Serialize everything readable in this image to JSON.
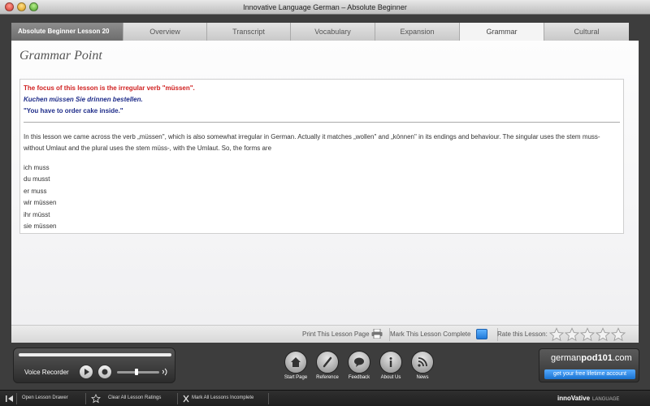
{
  "window": {
    "title": "Innovative Language German – Absolute Beginner"
  },
  "tabs": [
    {
      "label": "Absolute Beginner Lesson 20",
      "state": "current-lesson"
    },
    {
      "label": "Overview"
    },
    {
      "label": "Transcript"
    },
    {
      "label": "Vocabulary"
    },
    {
      "label": "Expansion"
    },
    {
      "label": "Grammar",
      "state": "active"
    },
    {
      "label": "Cultural"
    }
  ],
  "content": {
    "heading": "Grammar Point",
    "focus": "The focus of this lesson is the irregular verb \"müssen\".",
    "example_german": "Kuchen müssen Sie drinnen bestellen.",
    "example_english": "\"You have to order cake inside.\"",
    "paragraph": "In this lesson we came across the verb „müssen\", which is also somewhat irregular in German. Actually it matches „wollen\" and „können\" in its endings and behaviour. The singular uses the stem muss- without Umlaut and the plural uses the stem müss-, with the Umlaut. So, the forms are",
    "forms": [
      "ich muss",
      "du musst",
      "er muss",
      "wir müssen",
      "ihr müsst",
      "sie müssen"
    ]
  },
  "toolbar": {
    "print_label": "Print This Lesson Page",
    "mark_label": "Mark This Lesson Complete",
    "rate_label": "Rate this Lesson:",
    "rating": 0,
    "rating_max": 5
  },
  "recorder": {
    "label": "Voice Recorder",
    "volume_level": 0.45
  },
  "nav": [
    {
      "label": "Start Page",
      "icon": "home-icon"
    },
    {
      "label": "Reference",
      "icon": "reference-icon"
    },
    {
      "label": "Feedback",
      "icon": "feedback-icon"
    },
    {
      "label": "About Us",
      "icon": "info-icon"
    },
    {
      "label": "News",
      "icon": "rss-icon"
    }
  ],
  "promo": {
    "brand_left": "german",
    "brand_mid": "pod101",
    "brand_right": ".com",
    "cta": "get your free lifetime account"
  },
  "statusbar": {
    "open_drawer": "Open Lesson Drawer",
    "clear_ratings": "Clear All Lesson Ratings",
    "mark_incomplete": "Mark All Lessons Incomplete",
    "brand": "innoVative",
    "brand_sub": "LANGUAGE"
  },
  "colors": {
    "focus_red": "#d02020",
    "example_blue": "#1f2d8a",
    "accent_blue": "#1f79d8"
  }
}
